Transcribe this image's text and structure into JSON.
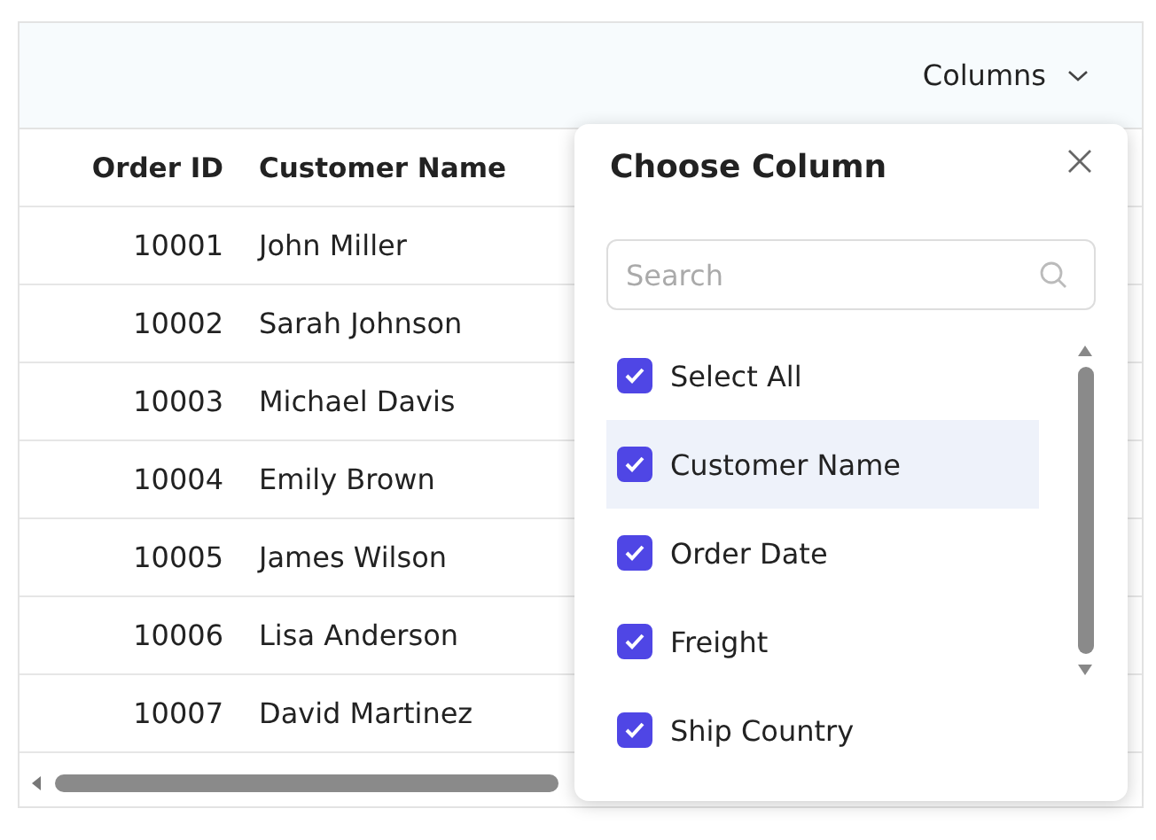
{
  "toolbar": {
    "columns_button": "Columns"
  },
  "table": {
    "columns": [
      "Order ID",
      "Customer Name"
    ],
    "rows": [
      [
        "10001",
        "John Miller"
      ],
      [
        "10002",
        "Sarah Johnson"
      ],
      [
        "10003",
        "Michael Davis"
      ],
      [
        "10004",
        "Emily Brown"
      ],
      [
        "10005",
        "James Wilson"
      ],
      [
        "10006",
        "Lisa Anderson"
      ],
      [
        "10007",
        "David Martinez"
      ]
    ]
  },
  "column_chooser": {
    "title": "Choose Column",
    "search": {
      "placeholder": "Search"
    },
    "items": [
      {
        "label": "Select All",
        "checked": true,
        "hovered": false
      },
      {
        "label": "Customer Name",
        "checked": true,
        "hovered": true
      },
      {
        "label": "Order Date",
        "checked": true,
        "hovered": false
      },
      {
        "label": "Freight",
        "checked": true,
        "hovered": false
      },
      {
        "label": "Ship Country",
        "checked": true,
        "hovered": false
      }
    ]
  }
}
